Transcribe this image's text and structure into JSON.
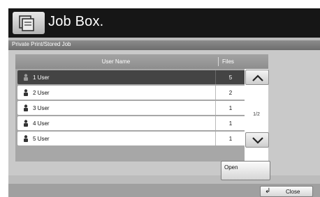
{
  "header": {
    "title": "Job Box.",
    "icon": "job-box-icon"
  },
  "sub_header": {
    "title": "Private Print/Stored Job"
  },
  "table": {
    "columns": [
      "User Name",
      "Files"
    ],
    "rows": [
      {
        "user": "1 User",
        "files": "5",
        "selected": true
      },
      {
        "user": "2 User",
        "files": "2",
        "selected": false
      },
      {
        "user": "3 User",
        "files": "1",
        "selected": false
      },
      {
        "user": "4 User",
        "files": "1",
        "selected": false
      },
      {
        "user": "5 User",
        "files": "1",
        "selected": false
      }
    ]
  },
  "pager": {
    "indicator": "1/2",
    "up_icon": "chevron-up-icon",
    "down_icon": "chevron-down-icon"
  },
  "buttons": {
    "open": "Open",
    "close": "Close",
    "close_icon": "return-arrow-icon",
    "close_glyph": "↲"
  },
  "colors": {
    "header_bg": "#161616",
    "selected_row": "#444444",
    "panel_bg": "#c9c9c9"
  }
}
